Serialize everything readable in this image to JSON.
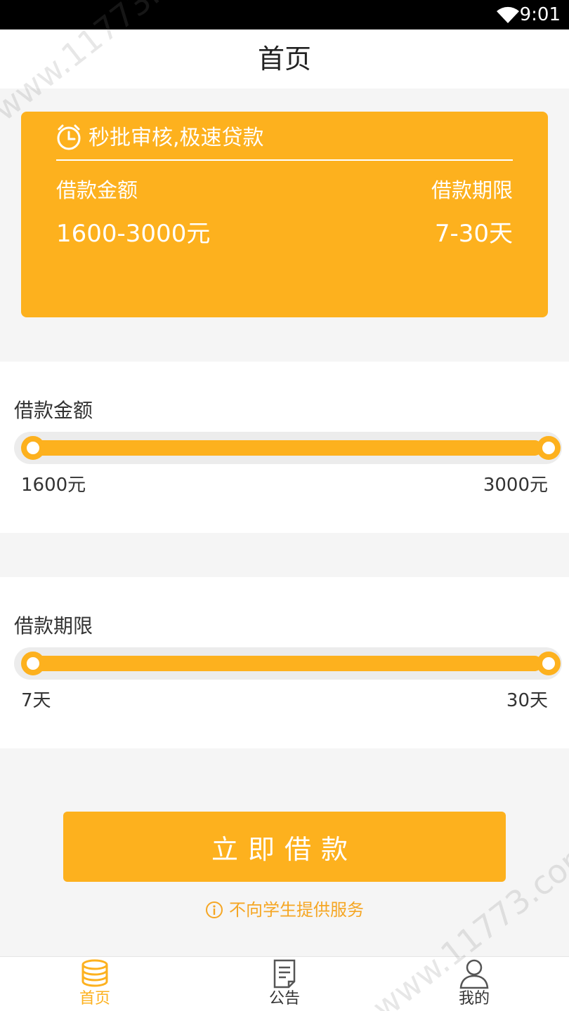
{
  "status_bar": {
    "time": "9:01"
  },
  "header": {
    "title": "首页"
  },
  "hero": {
    "tagline": "秒批审核,极速贷款",
    "amount_label": "借款金额",
    "term_label": "借款期限",
    "amount_value": "1600-3000元",
    "term_value": "7-30天"
  },
  "amount_slider": {
    "label": "借款金额",
    "min_text": "1600元",
    "max_text": "3000元",
    "fill_fraction": 1.0
  },
  "term_slider": {
    "label": "借款期限",
    "min_text": "7天",
    "max_text": "30天",
    "fill_fraction": 1.0
  },
  "borrow_button": {
    "label": "立即借款"
  },
  "notice": {
    "text": "不向学生提供服务",
    "icon": "info-icon"
  },
  "bottom_nav": [
    {
      "label": "首页",
      "icon": "coins-stack-icon",
      "active": true
    },
    {
      "label": "公告",
      "icon": "document-icon",
      "active": false
    },
    {
      "label": "我的",
      "icon": "user-icon",
      "active": false
    }
  ],
  "watermark": {
    "text": "www.11773.com"
  },
  "colors": {
    "accent": "#fdb11e",
    "notice": "#f5a623",
    "background": "#f5f5f5"
  }
}
